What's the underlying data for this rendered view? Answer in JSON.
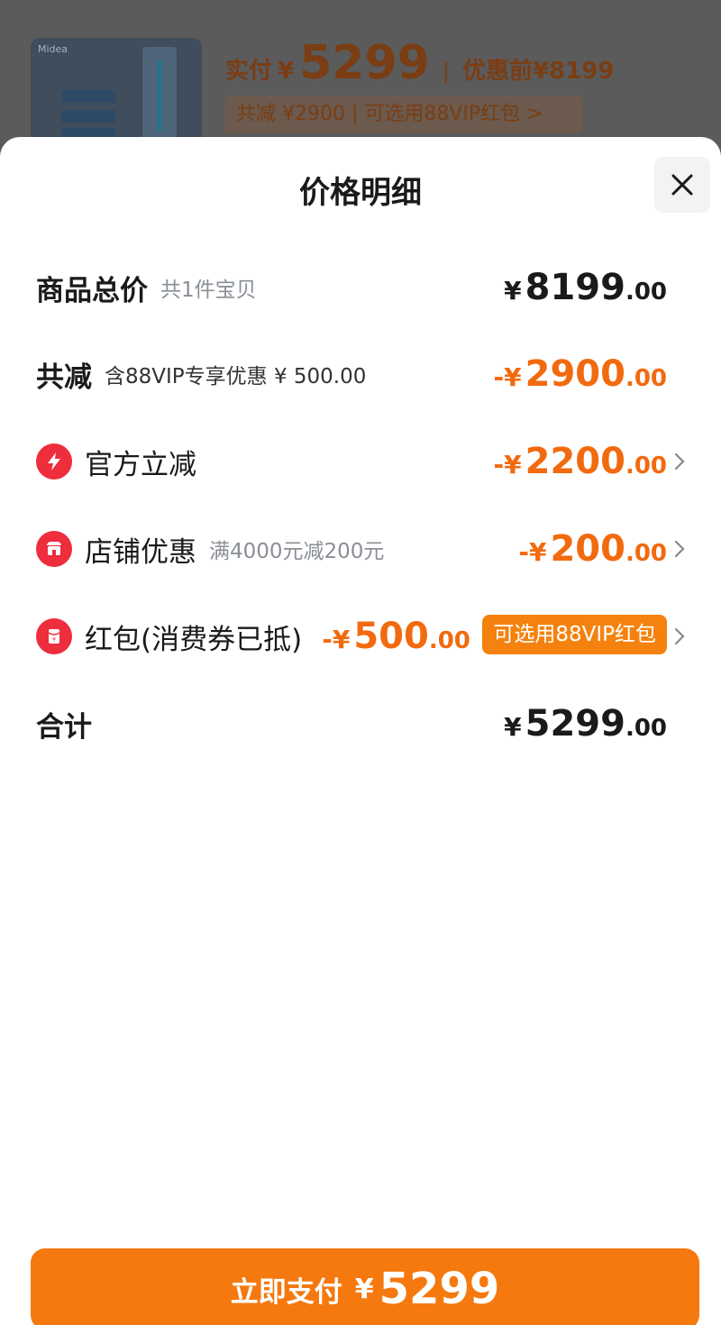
{
  "background": {
    "brand": "Midea",
    "paid_label": "实付",
    "currency": "¥",
    "paid_value": "5299",
    "divider": "|",
    "original_label": "优惠前",
    "original_value": "¥8199",
    "summary": "共减 ¥2900 | 可选用88VIP红包 >"
  },
  "sheet": {
    "title": "价格明细",
    "close_icon": "close-icon"
  },
  "rows": {
    "total": {
      "label": "商品总价",
      "sub": "共1件宝贝",
      "sym": "¥",
      "int": "8199",
      "dec": ".00"
    },
    "reduce": {
      "label": "共减",
      "sub": "含88VIP专享优惠 ¥ 500.00",
      "sym": "-¥",
      "int": "2900",
      "dec": ".00"
    },
    "official": {
      "label": "官方立减",
      "sym": "-¥",
      "int": "2200",
      "dec": ".00",
      "icon": "lightning-icon"
    },
    "shop": {
      "label": "店铺优惠",
      "sub": "满4000元减200元",
      "sym": "-¥",
      "int": "200",
      "dec": ".00",
      "icon": "shop-icon"
    },
    "redpack": {
      "label": "红包(消费券已抵)",
      "sym": "-¥",
      "int": "500",
      "dec": ".00",
      "badge": "可选用88VIP红包",
      "icon": "red-envelope-icon"
    },
    "sum": {
      "label": "合计",
      "sym": "¥",
      "int": "5299",
      "dec": ".00"
    }
  },
  "pay_button": {
    "label": "立即支付",
    "sym": "¥",
    "value": "5299"
  },
  "colors": {
    "accent": "#f26a0f",
    "button": "#f5790f",
    "icon_red": "#ee2d3d"
  }
}
